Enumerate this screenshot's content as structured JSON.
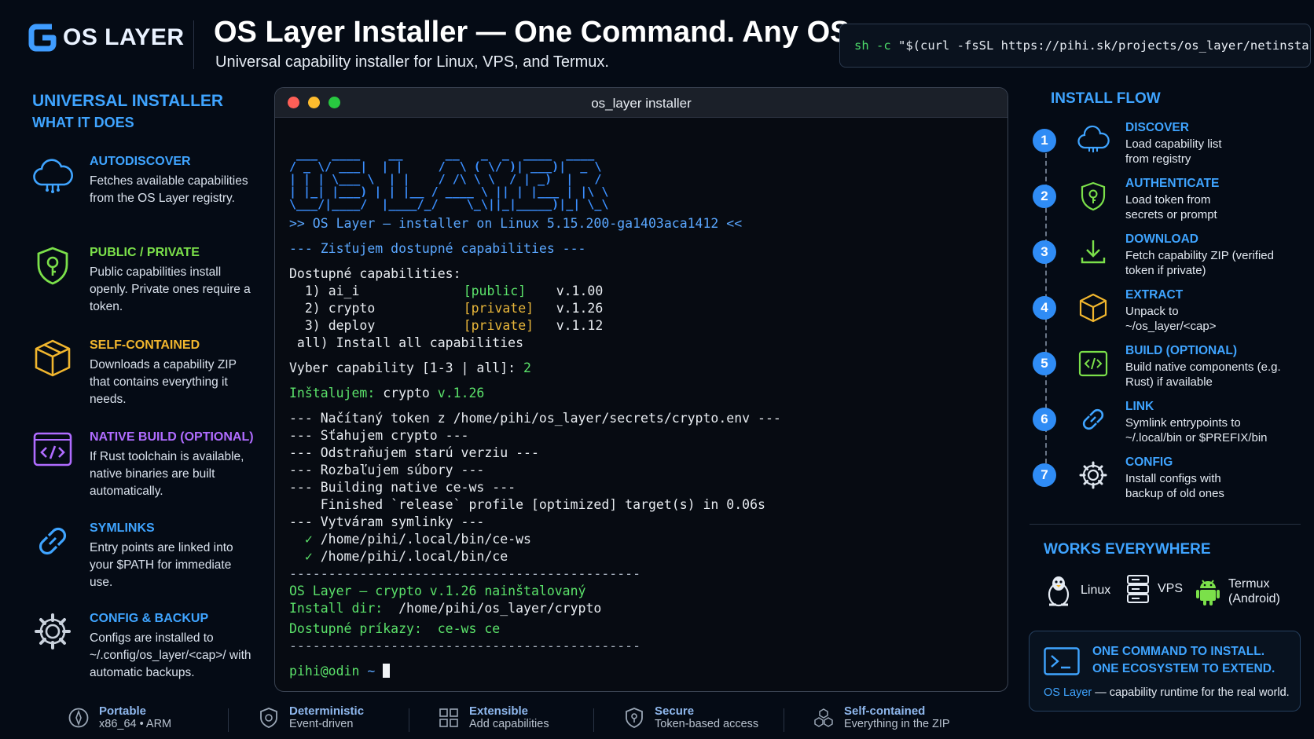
{
  "header": {
    "logo_text": "OS LAYER",
    "title": "OS Layer Installer — One Command. Any OS.",
    "subtitle": "Universal capability installer for Linux, VPS, and Termux.",
    "command": "sh -c \"$(curl -fsSL https://pihi.sk/projects/os_layer/netinstall.sh)\""
  },
  "left": {
    "heading1": "UNIVERSAL INSTALLER",
    "heading2": "WHAT IT DOES",
    "features": [
      {
        "title": "AUTODISCOVER",
        "desc": "Fetches available capabilities from the OS Layer registry.",
        "color": "#3fa4ff",
        "icon": "cloud-icon"
      },
      {
        "title": "PUBLIC / PRIVATE",
        "desc": "Public capabilities install openly. Private ones require a token.",
        "color": "#7be04a",
        "icon": "shield-key-icon"
      },
      {
        "title": "SELF-CONTAINED",
        "desc": "Downloads a capability ZIP that contains everything it needs.",
        "color": "#f1b62e",
        "icon": "package-icon"
      },
      {
        "title": "NATIVE BUILD (OPTIONAL)",
        "desc": "If Rust toolchain is available, native binaries are built automatically.",
        "color": "#b06cff",
        "icon": "code-icon"
      },
      {
        "title": "SYMLINKS",
        "desc": "Entry points are linked into your $PATH for immediate use.",
        "color": "#3fa4ff",
        "icon": "link-icon"
      },
      {
        "title": "CONFIG & BACKUP",
        "desc": "Configs are installed to ~/.config/os_layer/<cap>/ with automatic backups.",
        "color": "#3fa4ff",
        "icon": "gear-icon"
      }
    ]
  },
  "terminal": {
    "window_title": "os_layer installer",
    "ascii_banner": " ___  ____    __      __   _  _  ____  ____ \n/ _ \\/ ___|  | |     /  \\ ( \\/ )| ___)|  _ \\\n| | | \\___ \\  | |    / /\\ \\ \\  / | _)  |   /\n| |_| |___) | | |__ / ____ \\ || | |___ | |\\ \\\n\\___/|____/  |____/_/    \\_\\||_|_____)|_| \\_\\",
    "banner_line": ">> OS Layer — installer on Linux 5.15.200-ga1403aca1412 <<",
    "discover_line": "--- Zisťujem dostupné capabilities ---",
    "available_label": "Dostupné capabilities:",
    "capabilities": [
      {
        "index": "1)",
        "name": "ai_i",
        "visibility": "[public]",
        "version": "v.1.00"
      },
      {
        "index": "2)",
        "name": "crypto",
        "visibility": "[private]",
        "version": "v.1.26"
      },
      {
        "index": "3)",
        "name": "deploy",
        "visibility": "[private]",
        "version": "v.1.12"
      }
    ],
    "all_option": " all) Install all capabilities",
    "prompt_label": "Vyber capability [1-3 | all]: ",
    "prompt_answer": "2",
    "installing_label": "Inštalujem:",
    "installing_name": " crypto ",
    "installing_version": "v.1.26",
    "steps": [
      "--- Načítaný token z /home/pihi/os_layer/secrets/crypto.env ---",
      "--- Sťahujem crypto ---",
      "--- Odstraňujem starú verziu ---",
      "--- Rozbaľujem súbory ---",
      "--- Building native ce-ws ---",
      "    Finished `release` profile [optimized] target(s) in 0.06s",
      "--- Vytváram symlinky ---"
    ],
    "symlinks": [
      "/home/pihi/.local/bin/ce-ws",
      "/home/pihi/.local/bin/ce"
    ],
    "rule": "---------------------------------------------",
    "done_line": "OS Layer — crypto v.1.26 nainštalovaný",
    "install_dir_label": "Install dir: ",
    "install_dir": " /home/pihi/os_layer/crypto",
    "commands_label": "Dostupné príkazy: ",
    "commands": " ce-ws ce",
    "shell_user": "pihi@odin",
    "shell_path": " ~ "
  },
  "flow": {
    "heading": "INSTALL FLOW",
    "steps": [
      {
        "num": "1",
        "title": "DISCOVER",
        "desc": "Load capability list from registry",
        "icon": "cloud-icon"
      },
      {
        "num": "2",
        "title": "AUTHENTICATE",
        "desc": "Load token from secrets or prompt",
        "icon": "shield-key-icon"
      },
      {
        "num": "3",
        "title": "DOWNLOAD",
        "desc": "Fetch capability ZIP (verified token if private)",
        "icon": "download-icon"
      },
      {
        "num": "4",
        "title": "EXTRACT",
        "desc": "Unpack to ~/os_layer/<cap>",
        "icon": "package-icon"
      },
      {
        "num": "5",
        "title": "BUILD (OPTIONAL)",
        "desc": "Build native components (e.g. Rust) if available",
        "icon": "code-icon"
      },
      {
        "num": "6",
        "title": "LINK",
        "desc": "Symlink entrypoints to ~/.local/bin or $PREFIX/bin",
        "icon": "link-icon"
      },
      {
        "num": "7",
        "title": "CONFIG",
        "desc": "Install configs with backup of old ones",
        "icon": "gear-icon"
      }
    ]
  },
  "works": {
    "heading": "WORKS EVERYWHERE",
    "platforms": [
      {
        "label": "Linux",
        "icon": "tux-icon"
      },
      {
        "label": "VPS",
        "icon": "server-icon"
      },
      {
        "label": "Termux (Android)",
        "icon": "android-icon"
      }
    ]
  },
  "cta": {
    "line1": "ONE COMMAND TO INSTALL.",
    "line2": "ONE ECOSYSTEM TO EXTEND.",
    "brand": "OS Layer",
    "tagline": " — capability runtime for the real world."
  },
  "footer": [
    {
      "title": "Portable",
      "desc": "x86_64 • ARM",
      "icon": "compass-icon"
    },
    {
      "title": "Deterministic",
      "desc": "Event-driven",
      "icon": "shield-check-icon"
    },
    {
      "title": "Extensible",
      "desc": "Add capabilities",
      "icon": "puzzle-icon"
    },
    {
      "title": "Secure",
      "desc": "Token-based access",
      "icon": "lock-shield-icon"
    },
    {
      "title": "Self-contained",
      "desc": "Everything in the ZIP",
      "icon": "boxes-icon"
    }
  ],
  "colors": {
    "accent": "#3fa4ff",
    "green": "#5be26a",
    "yellow": "#e8b63a",
    "background": "#050b15"
  }
}
